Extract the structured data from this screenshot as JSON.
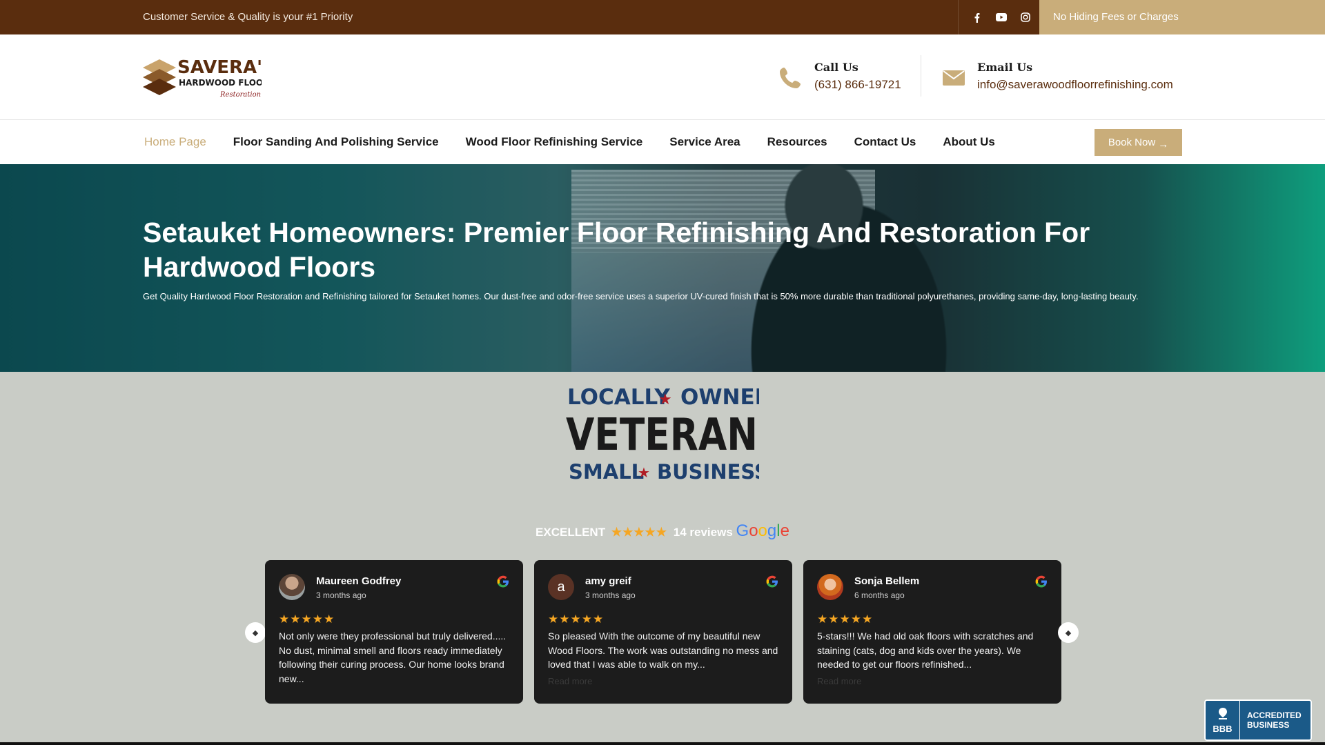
{
  "topbar": {
    "tagline": "Customer Service & Quality is your #1 Priority",
    "socials": [
      "facebook-icon",
      "youtube-icon",
      "instagram-icon"
    ],
    "promo": "No Hiding Fees or Charges"
  },
  "header": {
    "logo_text": "SAVERA'S",
    "logo_sub": "HARDWOOD FLOOR",
    "logo_script": "Restoration",
    "phone": {
      "label": "Call Us",
      "value": "(631) 866-19721"
    },
    "email": {
      "label": "Email Us",
      "value": "info@saverawoodfloorrefinishing.com"
    }
  },
  "nav": {
    "items": [
      "Home Page",
      "Floor Sanding And Polishing Service",
      "Wood Floor Refinishing Service",
      "Service Area",
      "Resources",
      "Contact Us",
      "About Us"
    ],
    "book_label": "Book Now"
  },
  "hero": {
    "title": "Setauket Homeowners: Premier Floor Refinishing And Restoration For Hardwood Floors",
    "text": "Get Quality Hardwood Floor Restoration and Refinishing tailored for Setauket homes. Our dust-free and odor-free service uses a superior UV-cured finish that is 50% more durable than traditional polyurethanes, providing same-day, long-lasting beauty."
  },
  "badge": {
    "line1": "LOCALLY",
    "line1b": "OWNED",
    "line2": "VETERAN",
    "line3": "SMALL",
    "line3b": "BUSINESS"
  },
  "reviews_summary": {
    "label": "EXCELLENT",
    "stars": "★★★★★",
    "count": "14 reviews",
    "rating": 5
  },
  "reviews": [
    {
      "name": "Maureen Godfrey",
      "when": "3 months ago",
      "stars": "★★★★★",
      "text": "Not only were they professional but truly delivered..... No dust, minimal smell and floors ready immediately following their curing process. Our home looks brand new...",
      "more": "",
      "avatar_letter": ""
    },
    {
      "name": "amy greif",
      "when": "3 months ago",
      "stars": "★★★★★",
      "text": "So pleased With the outcome of my beautiful new Wood Floors. The work was outstanding no mess and loved that I was able to walk on my...",
      "more": "Read more",
      "avatar_letter": "a"
    },
    {
      "name": "Sonja Bellem",
      "when": "6 months ago",
      "stars": "★★★★★",
      "text": "5-stars!!! We had old oak floors with scratches and staining (cats, dog and kids over the years). We needed to get our floors refinished...",
      "more": "Read more",
      "avatar_letter": ""
    }
  ],
  "bbb": {
    "seal": "BBB",
    "line1": "ACCREDITED",
    "line2": "BUSINESS"
  },
  "colors": {
    "brown": "#5a2d0e",
    "gold": "#c9ad7a",
    "teal": "#12d39c",
    "card": "#1c1c1c"
  }
}
